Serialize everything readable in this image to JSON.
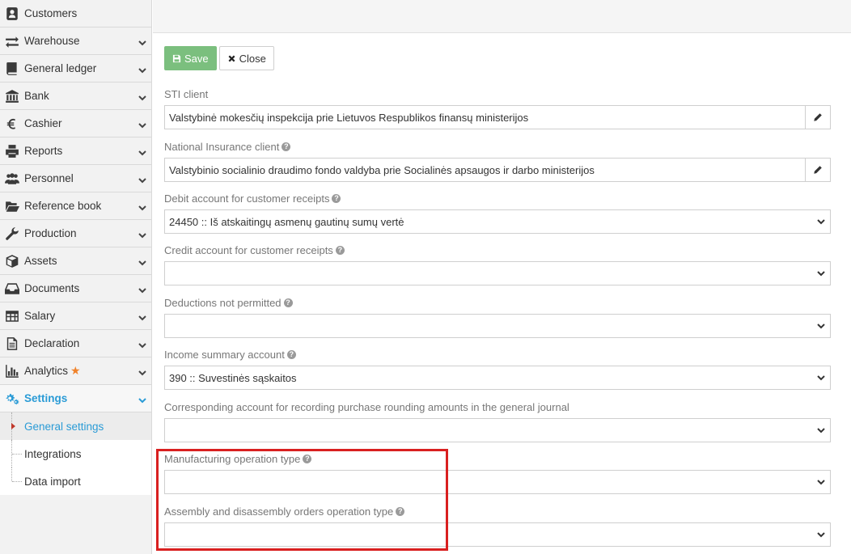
{
  "sidebar": {
    "items": [
      {
        "label": "Customers",
        "icon": "customers-icon",
        "chevron": false
      },
      {
        "label": "Warehouse",
        "icon": "warehouse-icon",
        "chevron": true
      },
      {
        "label": "General ledger",
        "icon": "general-ledger-icon",
        "chevron": true
      },
      {
        "label": "Bank",
        "icon": "bank-icon",
        "chevron": true
      },
      {
        "label": "Cashier",
        "icon": "euro-icon",
        "chevron": true
      },
      {
        "label": "Reports",
        "icon": "printer-icon",
        "chevron": true
      },
      {
        "label": "Personnel",
        "icon": "people-icon",
        "chevron": true
      },
      {
        "label": "Reference book",
        "icon": "folder-icon",
        "chevron": true
      },
      {
        "label": "Production",
        "icon": "wrench-icon",
        "chevron": true
      },
      {
        "label": "Assets",
        "icon": "cube-icon",
        "chevron": true
      },
      {
        "label": "Documents",
        "icon": "inbox-icon",
        "chevron": true
      },
      {
        "label": "Salary",
        "icon": "table-icon",
        "chevron": true
      },
      {
        "label": "Declaration",
        "icon": "document-icon",
        "chevron": true
      },
      {
        "label": "Analytics",
        "icon": "bar-chart-icon",
        "chevron": true,
        "starred": true
      },
      {
        "label": "Settings",
        "icon": "gears-icon",
        "chevron": true,
        "active": true
      }
    ],
    "subitems": [
      {
        "label": "General settings",
        "current": true
      },
      {
        "label": "Integrations"
      },
      {
        "label": "Data import"
      }
    ]
  },
  "toolbar": {
    "save_label": "Save",
    "close_label": "Close"
  },
  "form": {
    "sti_client": {
      "label": "STI client",
      "value": "Valstybinė mokesčių inspekcija prie Lietuvos Respublikos finansų ministerijos"
    },
    "ni_client": {
      "label": "National Insurance client",
      "value": "Valstybinio socialinio draudimo fondo valdyba prie Socialinės apsaugos ir darbo ministerijos"
    },
    "debit_account": {
      "label": "Debit account for customer receipts",
      "value": "24450 :: Iš atskaitingų asmenų gautinų sumų vertė"
    },
    "credit_account": {
      "label": "Credit account for customer receipts",
      "value": ""
    },
    "deductions": {
      "label": "Deductions not permitted",
      "value": ""
    },
    "income_summary": {
      "label": "Income summary account",
      "value": "390 :: Suvestinės sąskaitos"
    },
    "rounding_account": {
      "label": "Corresponding account for recording purchase rounding amounts in the general journal",
      "value": ""
    },
    "manufacturing_op": {
      "label": "Manufacturing operation type",
      "value": ""
    },
    "assembly_op": {
      "label": "Assembly and disassembly orders operation type",
      "value": ""
    }
  },
  "colors": {
    "accent": "#2a9bd6",
    "save": "#7bbf7e",
    "highlight": "#d92020",
    "star": "#f0822a"
  }
}
